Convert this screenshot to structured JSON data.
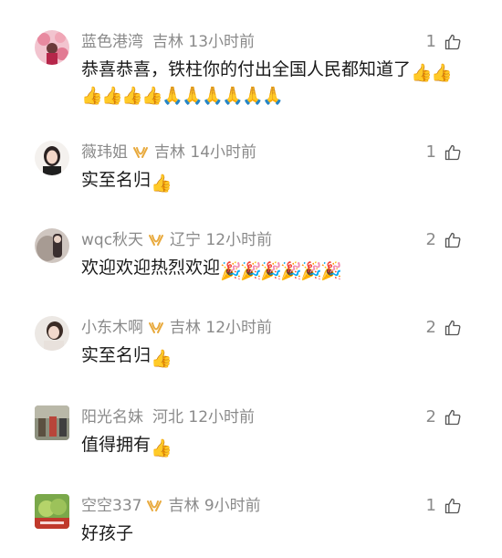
{
  "comments": [
    {
      "user": "蓝色港湾",
      "location": "吉林",
      "time": "13小时前",
      "likes": "1",
      "vip": false,
      "text": "恭喜恭喜，铁柱你的付出全国人民都知道了",
      "emojis_inline": [
        "thumbs-up",
        "thumbs-up"
      ],
      "emojis_line2": [
        "thumbs-up",
        "thumbs-up",
        "thumbs-up",
        "thumbs-up",
        "folded-hands",
        "folded-hands",
        "folded-hands",
        "folded-hands",
        "folded-hands",
        "folded-hands"
      ]
    },
    {
      "user": "薇玮姐",
      "location": "吉林",
      "time": "14小时前",
      "likes": "1",
      "vip": true,
      "text": "实至名归",
      "emojis_inline": [
        "thumbs-up"
      ]
    },
    {
      "user": "wqc秋天",
      "location": "辽宁",
      "time": "12小时前",
      "likes": "2",
      "vip": true,
      "text": "欢迎欢迎热烈欢迎",
      "emojis_inline": [
        "party-popper",
        "party-popper",
        "party-popper",
        "party-popper",
        "party-popper",
        "party-popper"
      ]
    },
    {
      "user": "小东木啊",
      "location": "吉林",
      "time": "12小时前",
      "likes": "2",
      "vip": true,
      "text": "实至名归",
      "emojis_inline": [
        "thumbs-up"
      ]
    },
    {
      "user": "阳光名妹",
      "location": "河北",
      "time": "12小时前",
      "likes": "2",
      "vip": false,
      "text": "值得拥有",
      "emojis_inline": [
        "thumbs-up"
      ]
    },
    {
      "user": "空空337",
      "location": "吉林",
      "time": "9小时前",
      "likes": "1",
      "vip": true,
      "text": "好孩子",
      "emojis_inline": []
    }
  ],
  "colors": {
    "meta_gray": "#8a8a8a",
    "text_dark": "#1a1a1a",
    "vip_gold": "#e8a93c"
  }
}
